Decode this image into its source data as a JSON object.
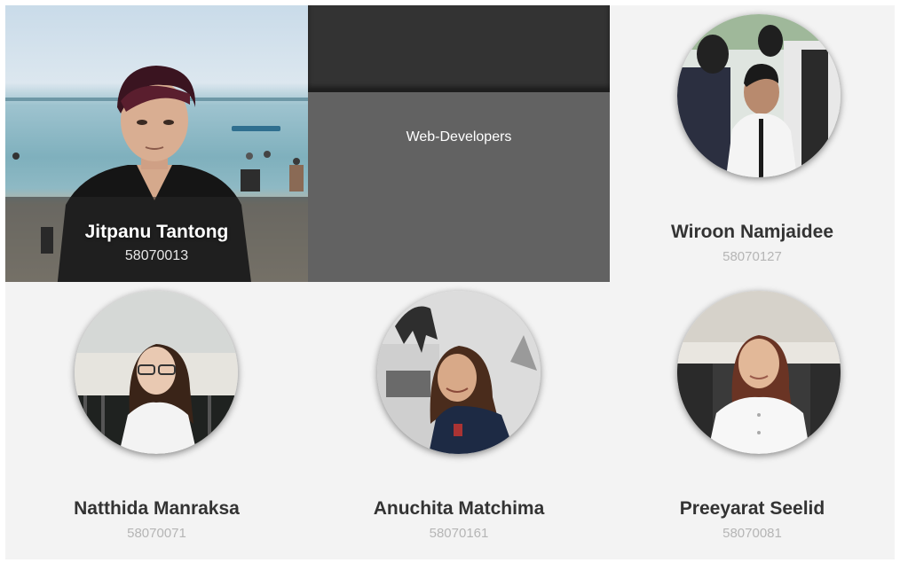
{
  "featured": {
    "name": "Jitpanu Tantong",
    "student_id": "58070013",
    "photo_icon": "person-photo"
  },
  "team": {
    "label": "Web-Developers"
  },
  "members": [
    {
      "name": "Wiroon Namjaidee",
      "student_id": "58070127",
      "photo_icon": "person-photo"
    },
    {
      "name": "Natthida Manraksa",
      "student_id": "58070071",
      "photo_icon": "person-photo"
    },
    {
      "name": "Anuchita Matchima",
      "student_id": "58070161",
      "photo_icon": "person-photo"
    },
    {
      "name": "Preeyarat Seelid",
      "student_id": "58070081",
      "photo_icon": "person-photo"
    }
  ],
  "colors": {
    "page_bg": "#f3f3f3",
    "team_top": "#333333",
    "team_body": "#626262",
    "name_text": "#333333",
    "id_text": "#b5b5b5"
  }
}
